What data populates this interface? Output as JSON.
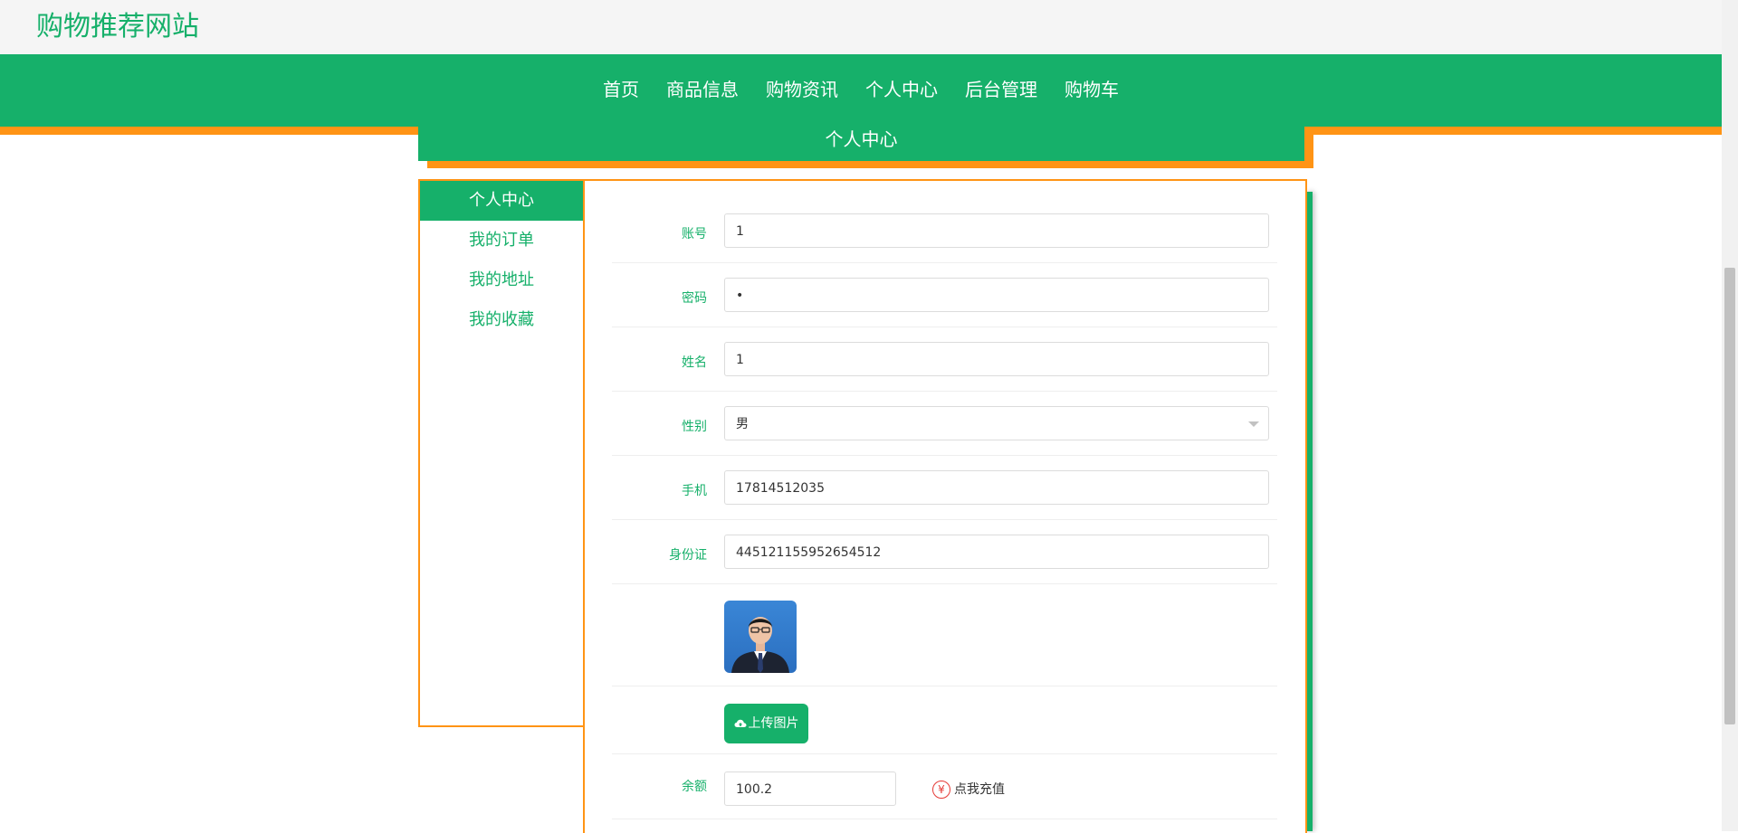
{
  "site": {
    "title": "购物推荐网站"
  },
  "nav": {
    "items": [
      {
        "label": "首页"
      },
      {
        "label": "商品信息"
      },
      {
        "label": "购物资讯"
      },
      {
        "label": "个人中心"
      },
      {
        "label": "后台管理"
      },
      {
        "label": "购物车"
      }
    ]
  },
  "banner": {
    "title": "个人中心"
  },
  "sidebar": {
    "items": [
      {
        "label": "个人中心",
        "active": true
      },
      {
        "label": "我的订单"
      },
      {
        "label": "我的地址"
      },
      {
        "label": "我的收藏"
      }
    ]
  },
  "form": {
    "account": {
      "label": "账号",
      "value": "1"
    },
    "password": {
      "label": "密码",
      "value": "•"
    },
    "name": {
      "label": "姓名",
      "value": "1"
    },
    "gender": {
      "label": "性别",
      "value": "男"
    },
    "phone": {
      "label": "手机",
      "value": "17814512035"
    },
    "id_card": {
      "label": "身份证",
      "value": "445121155952654512"
    },
    "upload_button": "上传图片",
    "balance": {
      "label": "余额",
      "value": "100.2"
    },
    "recharge_link": "点我充值"
  },
  "colors": {
    "primary": "#16b06a",
    "accent": "#ff9415"
  },
  "icons": {
    "upload": "cloud-upload-icon",
    "recharge": "yen-icon",
    "select": "chevron-down-icon"
  }
}
